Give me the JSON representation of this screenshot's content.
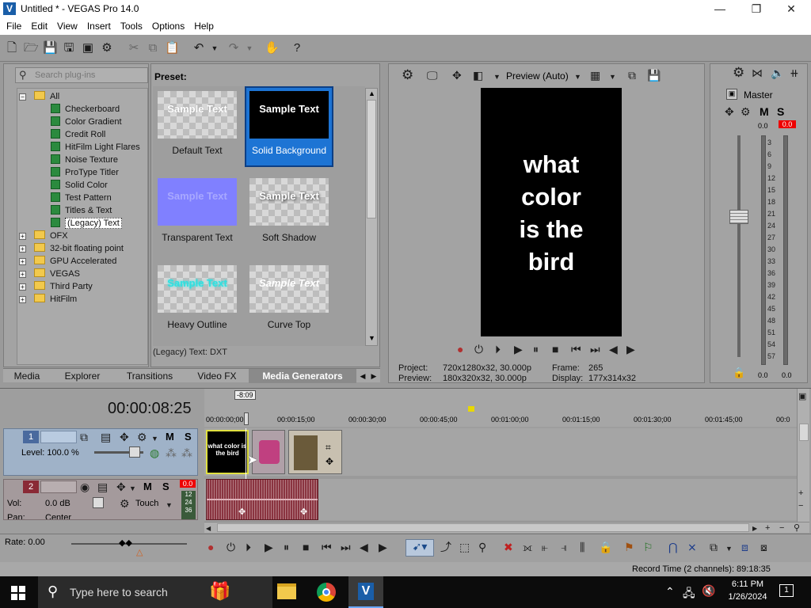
{
  "window": {
    "title": "Untitled * - VEGAS Pro 14.0"
  },
  "menu": [
    "File",
    "Edit",
    "View",
    "Insert",
    "Tools",
    "Options",
    "Help"
  ],
  "plugins": {
    "search_placeholder": "Search plug-ins",
    "tree": [
      {
        "label": "All",
        "type": "folder-open"
      },
      {
        "label": "Checkerboard",
        "type": "plugin"
      },
      {
        "label": "Color Gradient",
        "type": "plugin"
      },
      {
        "label": "Credit Roll",
        "type": "plugin"
      },
      {
        "label": "HitFilm Light Flares",
        "type": "plugin"
      },
      {
        "label": "Noise Texture",
        "type": "plugin"
      },
      {
        "label": "ProType Titler",
        "type": "plugin"
      },
      {
        "label": "Solid Color",
        "type": "plugin"
      },
      {
        "label": "Test Pattern",
        "type": "plugin"
      },
      {
        "label": "Titles & Text",
        "type": "plugin"
      },
      {
        "label": "(Legacy) Text",
        "type": "plugin-selected"
      },
      {
        "label": "OFX",
        "type": "folder"
      },
      {
        "label": "32-bit floating point",
        "type": "folder"
      },
      {
        "label": "GPU Accelerated",
        "type": "folder"
      },
      {
        "label": "VEGAS",
        "type": "folder"
      },
      {
        "label": "Third Party",
        "type": "folder"
      },
      {
        "label": "HitFilm",
        "type": "folder"
      }
    ]
  },
  "presets": {
    "header": "Preset:",
    "thumb_text": "Sample Text",
    "items": [
      {
        "label": "Default Text"
      },
      {
        "label": "Solid Background"
      },
      {
        "label": "Transparent Text"
      },
      {
        "label": "Soft Shadow"
      },
      {
        "label": "Heavy Outline"
      },
      {
        "label": "Curve Top"
      }
    ],
    "status": "(Legacy) Text: DXT"
  },
  "tabs": [
    "Media",
    "Explorer",
    "Transitions",
    "Video FX",
    "Media Generators"
  ],
  "preview": {
    "mode": "Preview (Auto)",
    "frame_text_lines": [
      "what",
      "color",
      "is the",
      "bird"
    ],
    "project_label": "Project:",
    "project_value": "720x1280x32, 30.000p",
    "preview_label": "Preview:",
    "preview_value": "180x320x32, 30.000p",
    "frame_label": "Frame:",
    "frame_value": "265",
    "display_label": "Display:",
    "display_value": "177x314x32"
  },
  "master": {
    "title": "Master",
    "m_label": "M",
    "s_label": "S",
    "left_level": "0.0",
    "right_level": "0.0",
    "scale": [
      "3",
      "6",
      "9",
      "12",
      "15",
      "18",
      "21",
      "24",
      "27",
      "30",
      "33",
      "36",
      "39",
      "42",
      "45",
      "48",
      "51",
      "54",
      "57"
    ],
    "bottom_left": "0.0",
    "bottom_right": "0.0"
  },
  "timeline": {
    "timecode": "00:00:08:25",
    "cursor_label": "-8:09",
    "ruler": [
      "00:00:00;00",
      "00:00:15;00",
      "00:00:30;00",
      "00:00:45;00",
      "00:01:00;00",
      "00:01:15;00",
      "00:01:30;00",
      "00:01:45;00",
      "00:0"
    ],
    "video_track": {
      "number": "1",
      "m": "M",
      "s": "S",
      "level": "Level: 100.0 %"
    },
    "audio_track": {
      "number": "2",
      "m": "M",
      "s": "S",
      "vol_label": "Vol:",
      "vol_value": "0.0 dB",
      "touch": "Touch",
      "pan_label": "Pan:",
      "pan_value": "Center",
      "peak": "0.0",
      "meter_scale": [
        "12",
        "24",
        "36"
      ]
    },
    "clip_text": "what color is the bird",
    "rate": "Rate: 0.00"
  },
  "status_bar": {
    "record_time": "Record Time (2 channels): 89:18:35"
  },
  "taskbar": {
    "search_placeholder": "Type here to search",
    "time": "6:11 PM",
    "date": "1/26/2024",
    "notifications": "1"
  }
}
